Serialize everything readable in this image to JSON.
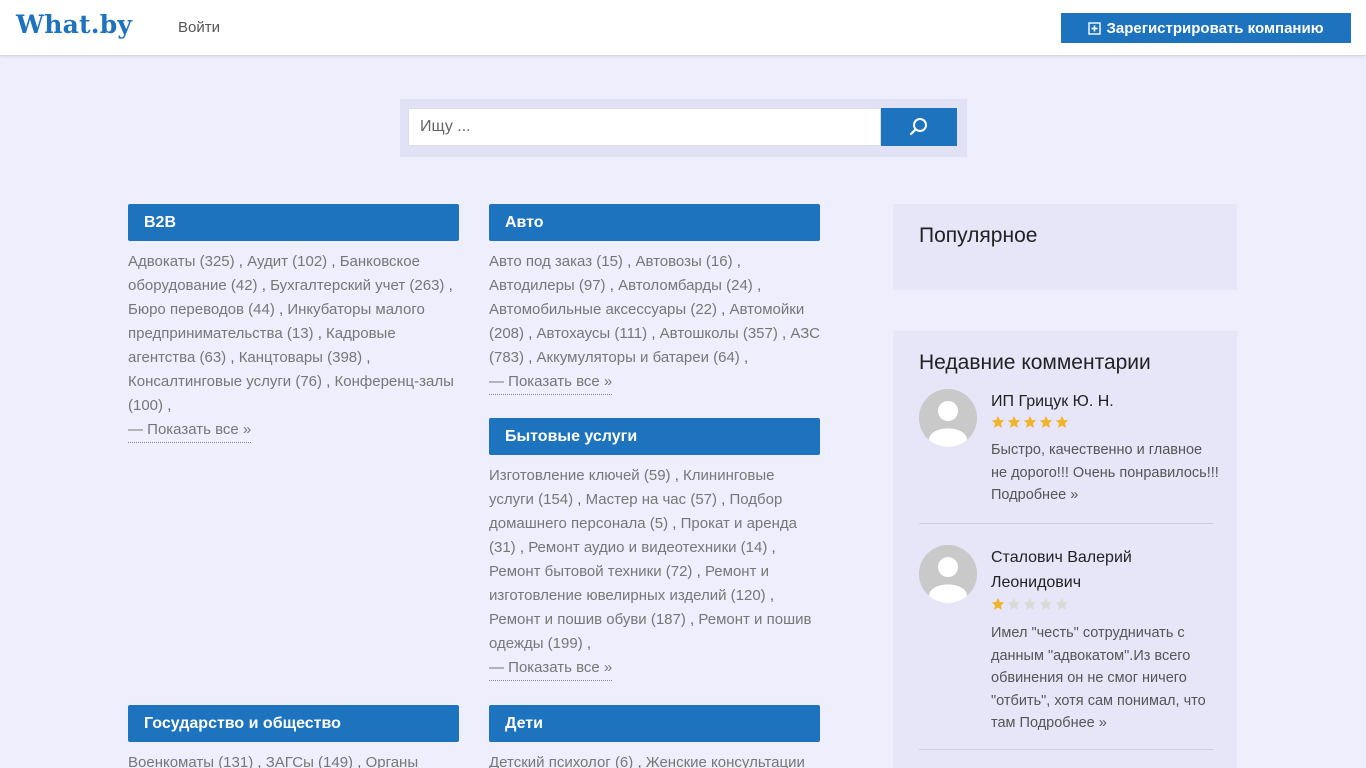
{
  "header": {
    "logo": "What.by",
    "login": "Войти",
    "register": "Зарегистрировать компанию"
  },
  "search": {
    "placeholder": "Ищу ..."
  },
  "categories": [
    {
      "title": "B2B",
      "items": [
        "Адвокаты (325)",
        "Аудит (102)",
        "Банковское оборудование (42)",
        "Бухгалтерский учет (263)",
        "Бюро переводов (44)",
        "Инкубаторы малого предпринимательства (13)",
        "Кадровые агентства (63)",
        "Канцтовары (398)",
        "Консалтинговые услуги (76)",
        "Конференц-залы (100)"
      ],
      "show_all": "— Показать все »"
    },
    {
      "title": "Авто",
      "items": [
        "Авто под заказ (15)",
        "Автовозы (16)",
        "Автодилеры (97)",
        "Автоломбарды (24)",
        "Автомобильные аксессуары (22)",
        "Автомойки (208)",
        "Автохаусы (111)",
        "Автошколы (357)",
        "АЗС (783)",
        "Аккумуляторы и батареи (64)"
      ],
      "show_all": "— Показать все »"
    },
    {
      "title": "Бытовые услуги",
      "items": [
        "Изготовление ключей (59)",
        "Клининговые услуги (154)",
        "Мастер на час (57)",
        "Подбор домашнего персонала (5)",
        "Прокат и аренда (31)",
        "Ремонт аудио и видеотехники (14)",
        "Ремонт бытовой техники (72)",
        "Ремонт и изготовление ювелирных изделий (120)",
        "Ремонт и пошив обуви (187)",
        "Ремонт и пошив одежды (199)"
      ],
      "show_all": "— Показать все »"
    },
    {
      "title": "Государство и общество",
      "items": [
        "Военкоматы (131)",
        "ЗАГСы (149)",
        "Органы"
      ],
      "show_all": ""
    },
    {
      "title": "Дети",
      "items": [
        "Детский психолог (6)",
        "Женские консультации"
      ],
      "show_all": ""
    }
  ],
  "sidebar": {
    "popular_title": "Популярное",
    "comments_title": "Недавние комментарии",
    "comments": [
      {
        "author": "ИП Грицук Ю. Н.",
        "rating": 5,
        "text": "Быстро, качественно и главное не дорого!!! Очень понравилось!!!",
        "more": "Подробнее »"
      },
      {
        "author": "Сталович Валерий Леонидович",
        "rating": 1,
        "text": "Имел \"честь\" сотрудничать с данным \"адвокатом\".Из всего обвинения он не смог ничего \"отбить\", хотя сам понимал, что там",
        "more": "Подробнее »"
      }
    ]
  },
  "colors": {
    "accent": "#1e73be",
    "background": "#eeeefc",
    "star_on": "#f0b429",
    "star_off": "#d9d9d9"
  },
  "icons": {
    "search": "search-icon",
    "register": "plus-square-icon",
    "avatar": "user-avatar-icon",
    "star": "star-icon"
  }
}
